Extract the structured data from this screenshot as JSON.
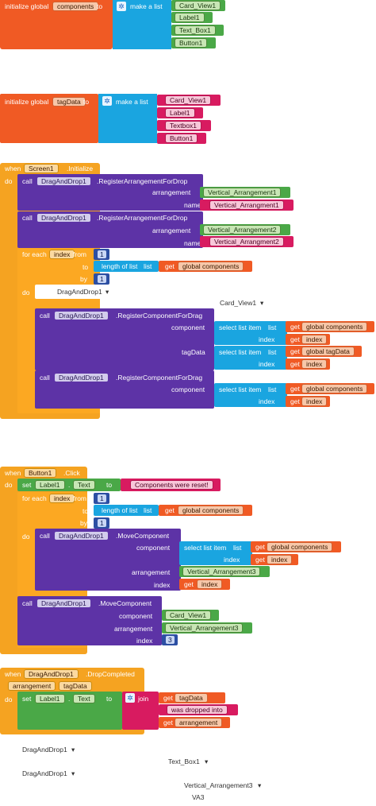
{
  "global1": {
    "init": "initialize global",
    "name": "components",
    "to": "to",
    "make_list": "make a list",
    "items": [
      "Card_View1",
      "Label1",
      "Text_Box1",
      "Button1"
    ]
  },
  "global2": {
    "init": "initialize global",
    "name": "tagData",
    "to": "to",
    "make_list": "make a list",
    "items": [
      "Card_View1",
      "Label1",
      "Textbox1",
      "Button1"
    ]
  },
  "screen_init": {
    "when": "when",
    "component": "Screen1",
    "event": ".Initialize",
    "do": "do",
    "call1": {
      "call": "call",
      "comp": "DragAndDrop1",
      "method": ".RegisterArrangementForDrop",
      "arrangement_label": "arrangement",
      "arrangement": "Vertical_Arrangement1",
      "name_label": "name",
      "name": "Vertical_Arrangment1"
    },
    "call2": {
      "call": "call",
      "comp": "DragAndDrop1",
      "method": ".RegisterArrangementForDrop",
      "arrangement_label": "arrangement",
      "arrangement": "Vertical_Arrangement2",
      "name_label": "name",
      "name": "Vertical_Arrangment2"
    },
    "loop": {
      "for_each": "for each",
      "var": "index",
      "from": "from",
      "from_val": "1",
      "to": "to",
      "length": "length of list",
      "list": "list",
      "get": "get",
      "global": "global components",
      "by": "by",
      "by_val": "1",
      "do": "do"
    },
    "floating1": "DragAndDrop1",
    "floating2": "Card_View1",
    "call3": {
      "call": "call",
      "comp": "DragAndDrop1",
      "method": ".RegisterComponentForDrag",
      "component_label": "component",
      "select": "select list item",
      "list": "list",
      "get": "get",
      "global": "global components",
      "index_label": "index",
      "index": "index",
      "tag_label": "tagData",
      "global2": "global tagData"
    },
    "call4": {
      "call": "call",
      "comp": "DragAndDrop1",
      "method": ".RegisterComponentForDrag",
      "component_label": "component",
      "select": "select list item",
      "list": "list",
      "get": "get",
      "global": "global components",
      "index_label": "index",
      "index": "index"
    }
  },
  "button_click": {
    "when": "when",
    "component": "Button1",
    "event": ".Click",
    "do": "do",
    "set": "set",
    "set_comp": "Label1",
    "set_prop": "Text",
    "set_to": "to",
    "set_val": "Components were reset!",
    "loop": {
      "for_each": "for each",
      "var": "index",
      "from": "from",
      "from_val": "1",
      "to": "to",
      "length": "length of list",
      "list": "list",
      "get": "get",
      "global": "global components",
      "by": "by",
      "by_val": "1",
      "do": "do"
    },
    "move1": {
      "call": "call",
      "comp": "DragAndDrop1",
      "method": ".MoveComponent",
      "component_label": "component",
      "select": "select list item",
      "list": "list",
      "get": "get",
      "global": "global components",
      "index_label": "index",
      "index": "index",
      "arrangement_label": "arrangement",
      "arrangement": "Vertical_Arrangement3"
    },
    "move2": {
      "call": "call",
      "comp": "DragAndDrop1",
      "method": ".MoveComponent",
      "component_label": "component",
      "component": "Card_View1",
      "arrangement_label": "arrangement",
      "arrangement": "Vertical_Arrangement3",
      "index_label": "index",
      "index_val": "3"
    }
  },
  "drop_completed": {
    "when": "when",
    "component": "DragAndDrop1",
    "event": ".DropCompleted",
    "param1": "arrangement",
    "param2": "tagData",
    "do": "do",
    "set": "set",
    "set_comp": "Label1",
    "set_prop": "Text",
    "set_to": "to",
    "join": "join",
    "get": "get",
    "get1": "tagData",
    "str": "was dropped into",
    "get2": "arrangement"
  },
  "loose": {
    "a": "DragAndDrop1",
    "b": "Text_Box1",
    "c": "DragAndDrop1",
    "d": "Vertical_Arrangement3",
    "e": "VA3"
  }
}
